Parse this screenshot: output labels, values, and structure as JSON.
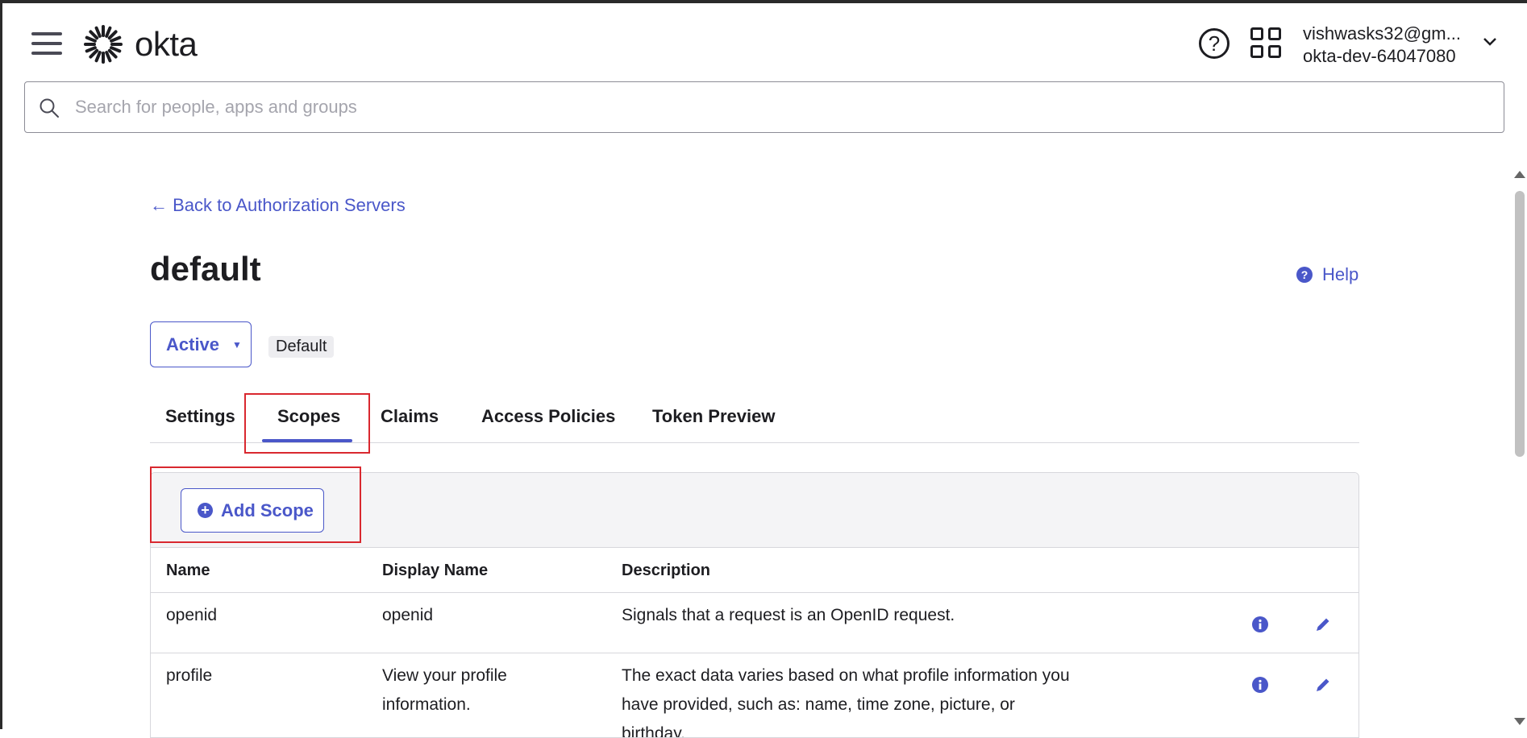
{
  "header": {
    "logo_text": "okta",
    "help_glyph": "?",
    "user_email": "vishwasks32@gm...",
    "org_name": "okta-dev-64047080"
  },
  "search": {
    "placeholder": "Search for people, apps and groups"
  },
  "page": {
    "back_link": "← Back to Authorization Servers",
    "title": "default",
    "help_label": "Help",
    "help_icon_glyph": "?",
    "status_label": "Active",
    "status_caret": "▼",
    "badge": "Default"
  },
  "tabs": [
    {
      "label": "Settings"
    },
    {
      "label": "Scopes"
    },
    {
      "label": "Claims"
    },
    {
      "label": "Access Policies"
    },
    {
      "label": "Token Preview"
    }
  ],
  "scopes": {
    "add_label": "Add Scope",
    "add_glyph": "+",
    "columns": [
      "Name",
      "Display Name",
      "Description"
    ],
    "rows": [
      {
        "name": "openid",
        "display": "openid",
        "description": "Signals that a request is an OpenID request."
      },
      {
        "name": "profile",
        "display": "View your profile information.",
        "description": "The exact data varies based on what profile information you have provided, such as: name, time zone, picture, or birthday."
      }
    ]
  },
  "colors": {
    "accent": "#4a57c9",
    "highlight_box": "#d9282f"
  }
}
